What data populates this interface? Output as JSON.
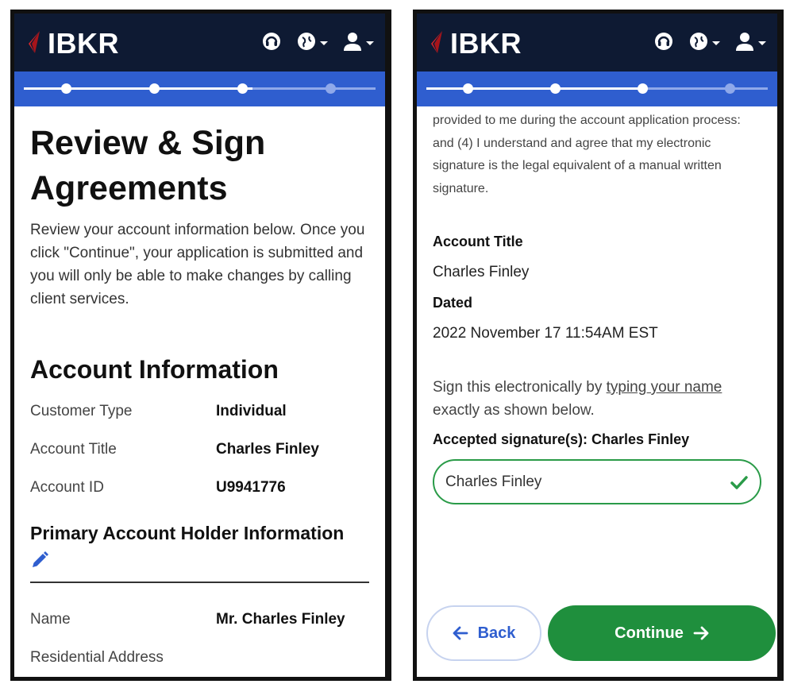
{
  "brand": {
    "name": "IBKR"
  },
  "left": {
    "title_line1": "Review & Sign",
    "title_line2": "Agreements",
    "intro": "Review your account information below. Once you click \"Continue\", your application is submitted and you will only be able to make changes by calling client services.",
    "account_info_heading": "Account Information",
    "rows": [
      {
        "label": "Customer Type",
        "value": "Individual"
      },
      {
        "label": "Account Title",
        "value": "Charles Finley"
      },
      {
        "label": "Account ID",
        "value": "U9941776"
      }
    ],
    "holder_heading": "Primary Account Holder Information",
    "holder_rows": [
      {
        "label": "Name",
        "value": "Mr. Charles Finley"
      },
      {
        "label": "Residential Address",
        "value": ""
      }
    ]
  },
  "right": {
    "legal_text": "provided to me during the account application process: and (4) I understand and agree that my electronic signature is the legal equivalent of a manual written signature.",
    "account_title_label": "Account Title",
    "account_title_value": "Charles Finley",
    "dated_label": "Dated",
    "dated_value": "2022 November 17 11:54AM EST",
    "sign_prefix": "Sign this electronically by ",
    "sign_link": "typing your name",
    "sign_suffix": "exactly as shown below.",
    "accepted_label": "Accepted signature(s): Charles Finley",
    "signature_value": "Charles Finley",
    "back_label": "Back",
    "continue_label": "Continue"
  },
  "progress": {
    "completed_steps": 3,
    "total_steps": 4
  },
  "colors": {
    "header_bg": "#0e1a33",
    "progress_bg": "#2f5ecf",
    "accent_blue": "#2f5ecf",
    "success_green": "#1f8f3d",
    "brand_red": "#d8252a"
  },
  "icons": [
    "ibkr-logo-icon",
    "headset-icon",
    "globe-icon",
    "user-icon",
    "pencil-icon",
    "check-icon",
    "arrow-left-icon",
    "arrow-right-icon"
  ]
}
